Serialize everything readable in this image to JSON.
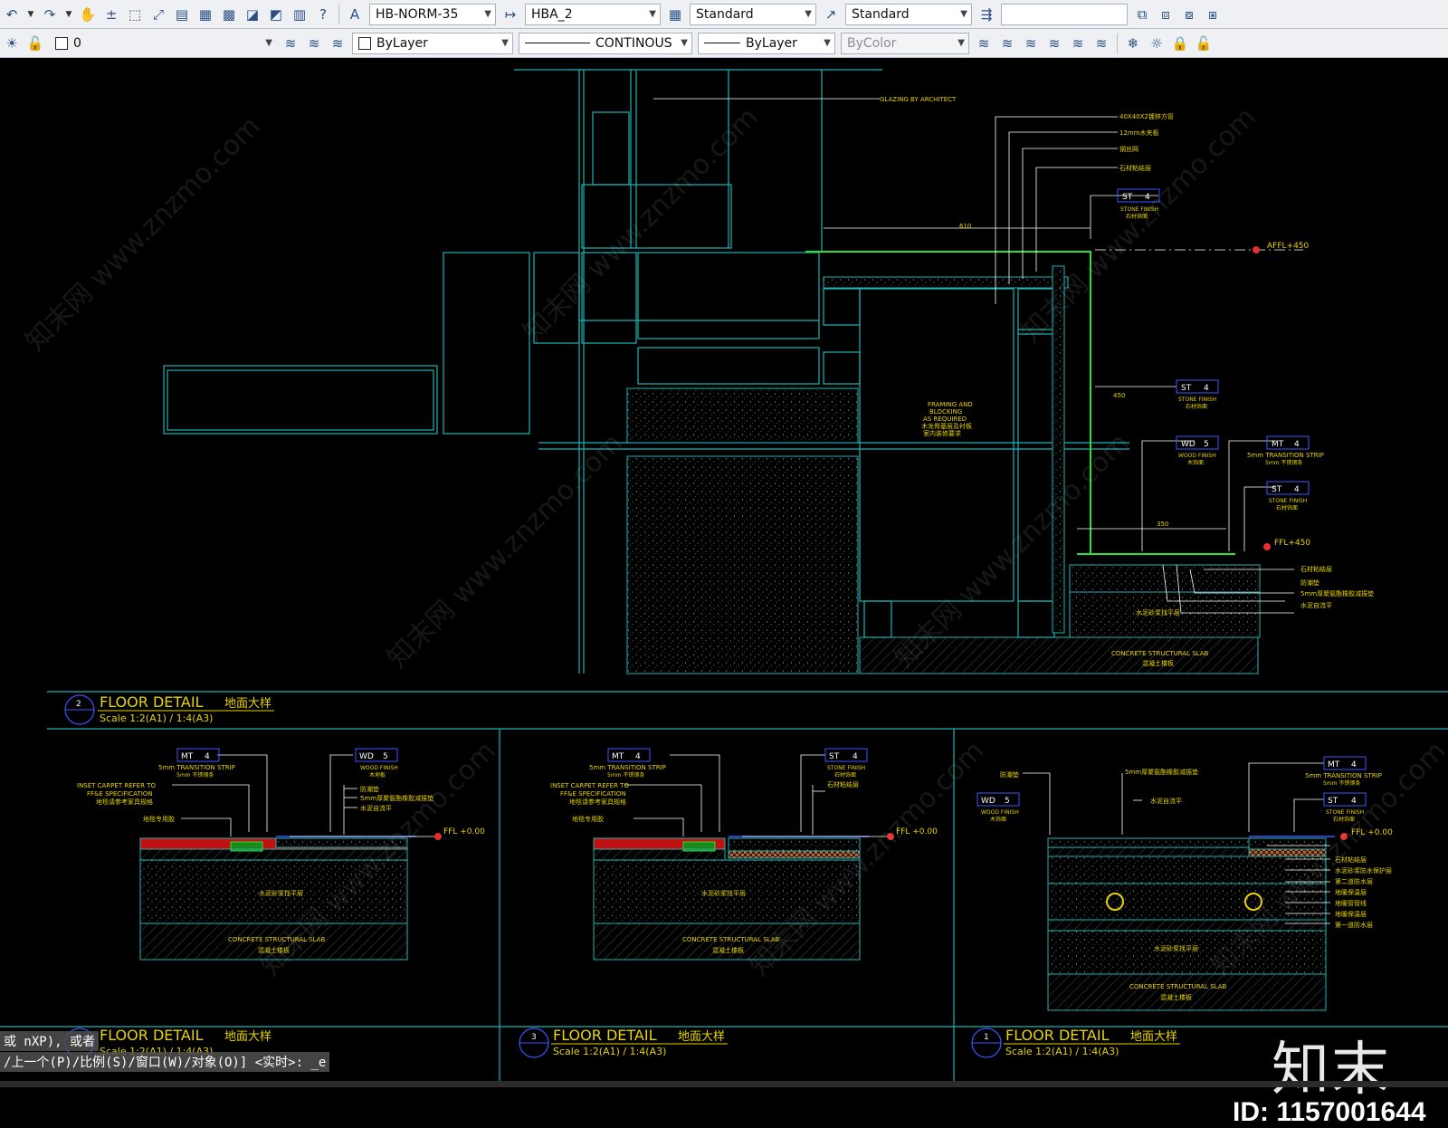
{
  "toolbar1": {
    "text_style": "HB-NORM-35",
    "dim_style": "HBA_2",
    "table_style": "Standard",
    "multileader_style": "Standard",
    "search_value": ""
  },
  "toolbar2": {
    "layer_name": "0",
    "color": "ByLayer",
    "linetype": "CONTINOUS",
    "lineweight": "ByLayer",
    "plot_style": "ByColor"
  },
  "drawing": {
    "top": {
      "glazing_note": "GLAZING BY\nARCHITECT",
      "notes_cn": [
        "40X40X2镀锌方管",
        "12mm木夹板",
        "钢丝网",
        "石材粘结层"
      ],
      "st_tag_1": {
        "code": "ST",
        "num": "4",
        "en": "STONE FINISH",
        "cn": "石材饰面"
      },
      "st_tag_2": {
        "code": "ST",
        "num": "4",
        "en": "STONE FINISH",
        "cn": "石材饰面"
      },
      "st_tag_3": {
        "code": "ST",
        "num": "4",
        "en": "STONE FINISH",
        "cn": "石材饰面"
      },
      "wd_tag": {
        "code": "WD",
        "num": "5",
        "en": "WOOD FINISH",
        "cn": "木饰面"
      },
      "mt_tag": {
        "code": "MT",
        "num": "4",
        "en": "5mm TRANSITION STRIP",
        "cn": "5mm 不锈钢条"
      },
      "framing_note": [
        "FRAMING AND",
        "BLOCKING",
        "AS REQUIRED",
        "木龙骨基层及衬板",
        "室内装修要求"
      ],
      "dim_610": "610",
      "dim_450": "450",
      "dim_350": "350",
      "affl": "AFFL+450",
      "ffl": "FFL+450",
      "bottom_notes_cn": [
        "石材粘结层",
        "防潮垫",
        "5mm厚聚氨酯橡胶减振垫",
        "水泥自流平"
      ],
      "screed_cn": "水泥砂浆找平层",
      "slab_en": "CONCRETE STRUCTURAL SLAB",
      "slab_cn": "混凝土楼板"
    },
    "title_2": {
      "num": "2",
      "title": "FLOOR DETAIL",
      "title_cn": "地面大样",
      "scale": "Scale 1:2(A1) / 1:4(A3)"
    },
    "panel_left": {
      "mt_tag": {
        "code": "MT",
        "num": "4",
        "en": "5mm TRANSITION STRIP",
        "cn": "5mm 不锈钢条"
      },
      "wd_tag": {
        "code": "WD",
        "num": "5",
        "en": "WOOD FINISH",
        "cn": "木地板"
      },
      "carpet_note": [
        "INSET CARPET REFER TO",
        "FF&E SPECIFICATION",
        "地毯请参考家具规格"
      ],
      "glue_cn": "地毯专用胶",
      "right_notes_cn": [
        "防潮垫",
        "5mm厚聚氨酯橡胶减振垫",
        "水泥自流平"
      ],
      "ffl": "FFL +0.00",
      "screed_cn": "水泥砂浆找平层",
      "slab_en": "CONCRETE STRUCTURAL SLAB",
      "slab_cn": "混凝土楼板"
    },
    "panel_mid": {
      "mt_tag": {
        "code": "MT",
        "num": "4",
        "en": "5mm TRANSITION STRIP",
        "cn": "5mm 不锈钢条"
      },
      "st_tag": {
        "code": "ST",
        "num": "4",
        "en": "STONE FINISH",
        "cn": "石材饰面"
      },
      "carpet_note": [
        "INSET CARPET REFER TO",
        "FF&E SPECIFICATION",
        "地毯请参考家具规格"
      ],
      "glue_cn": "地毯专用胶",
      "right_notes_cn": [
        "石材粘结层"
      ],
      "ffl": "FFL +0.00",
      "screed_cn": "水泥砂浆找平层",
      "slab_en": "CONCRETE STRUCTURAL SLAB",
      "slab_cn": "混凝土楼板"
    },
    "panel_right": {
      "wd_tag": {
        "code": "WD",
        "num": "5",
        "en": "WOOD FINISH",
        "cn": "木饰面"
      },
      "mt_tag": {
        "code": "MT",
        "num": "4",
        "en": "5mm TRANSITION STRIP",
        "cn": "5mm 不锈钢条"
      },
      "st_tag": {
        "code": "ST",
        "num": "4",
        "en": "STONE FINISH",
        "cn": "石材饰面"
      },
      "top_notes_cn": [
        "防潮垫",
        "5mm厚聚氨酯橡胶减振垫",
        "水泥自流平"
      ],
      "right_notes_cn": [
        "石材粘结层",
        "水泥砂浆防水保护层",
        "第二道防水层",
        "地暖保温层",
        "地暖管管线",
        "地暖保温层",
        "第一道防水层"
      ],
      "ffl": "FFL +0.00",
      "screed_cn": "水泥砂浆找平层",
      "slab_en": "CONCRETE STRUCTURAL SLAB",
      "slab_cn": "混凝土楼板"
    },
    "title_3": {
      "num": "3",
      "title": "FLOOR DETAIL",
      "title_cn": "地面大样",
      "scale": "Scale 1:2(A1) / 1:4(A3)"
    },
    "title_1": {
      "num": "1",
      "title": "FLOOR DETAIL",
      "title_cn": "地面大样",
      "scale": "Scale 1:2(A1) / 1:4(A3)"
    },
    "title_left_partial": {
      "num": "",
      "title": "FLOOR DETAIL",
      "title_cn": "地面大样",
      "scale": "Scale 1:2(A1) / 1:4(A3)"
    }
  },
  "command_line": {
    "line1": "或 nXP), 或者",
    "line2": "/上一个(P)/比例(S)/窗口(W)/对象(O)] <实时>: _e"
  },
  "watermark": "知末网 www.znzmo.com",
  "brand_logo": "知末",
  "brand_id": "ID: 1157001644"
}
